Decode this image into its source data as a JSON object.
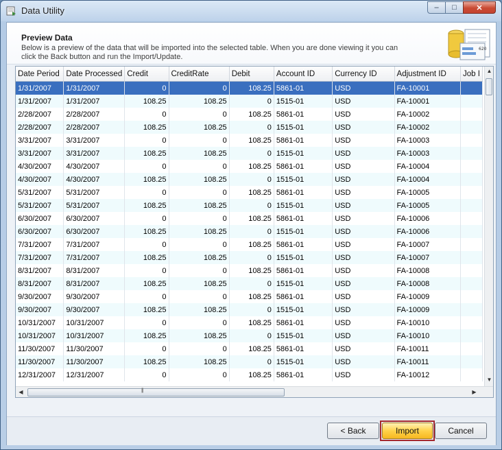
{
  "window": {
    "title": "Data Utility",
    "minimize": "‒",
    "maximize": "□",
    "close": "✕"
  },
  "header": {
    "title": "Preview Data",
    "description": "Below is a preview of the data that will be imported into the selected table.  When you are done viewing it you can click the Back button and run the Import/Update.",
    "icon_badge": "620"
  },
  "grid": {
    "columns": [
      "Date Period",
      "Date Processed",
      "Credit",
      "CreditRate",
      "Debit",
      "Account ID",
      "Currency ID",
      "Adjustment ID",
      "Job I"
    ],
    "rows": [
      [
        "1/31/2007",
        "1/31/2007",
        "0",
        "0",
        "108.25",
        "5861-01",
        "USD",
        "FA-10001",
        ""
      ],
      [
        "1/31/2007",
        "1/31/2007",
        "108.25",
        "108.25",
        "0",
        "1515-01",
        "USD",
        "FA-10001",
        ""
      ],
      [
        "2/28/2007",
        "2/28/2007",
        "0",
        "0",
        "108.25",
        "5861-01",
        "USD",
        "FA-10002",
        ""
      ],
      [
        "2/28/2007",
        "2/28/2007",
        "108.25",
        "108.25",
        "0",
        "1515-01",
        "USD",
        "FA-10002",
        ""
      ],
      [
        "3/31/2007",
        "3/31/2007",
        "0",
        "0",
        "108.25",
        "5861-01",
        "USD",
        "FA-10003",
        ""
      ],
      [
        "3/31/2007",
        "3/31/2007",
        "108.25",
        "108.25",
        "0",
        "1515-01",
        "USD",
        "FA-10003",
        ""
      ],
      [
        "4/30/2007",
        "4/30/2007",
        "0",
        "0",
        "108.25",
        "5861-01",
        "USD",
        "FA-10004",
        ""
      ],
      [
        "4/30/2007",
        "4/30/2007",
        "108.25",
        "108.25",
        "0",
        "1515-01",
        "USD",
        "FA-10004",
        ""
      ],
      [
        "5/31/2007",
        "5/31/2007",
        "0",
        "0",
        "108.25",
        "5861-01",
        "USD",
        "FA-10005",
        ""
      ],
      [
        "5/31/2007",
        "5/31/2007",
        "108.25",
        "108.25",
        "0",
        "1515-01",
        "USD",
        "FA-10005",
        ""
      ],
      [
        "6/30/2007",
        "6/30/2007",
        "0",
        "0",
        "108.25",
        "5861-01",
        "USD",
        "FA-10006",
        ""
      ],
      [
        "6/30/2007",
        "6/30/2007",
        "108.25",
        "108.25",
        "0",
        "1515-01",
        "USD",
        "FA-10006",
        ""
      ],
      [
        "7/31/2007",
        "7/31/2007",
        "0",
        "0",
        "108.25",
        "5861-01",
        "USD",
        "FA-10007",
        ""
      ],
      [
        "7/31/2007",
        "7/31/2007",
        "108.25",
        "108.25",
        "0",
        "1515-01",
        "USD",
        "FA-10007",
        ""
      ],
      [
        "8/31/2007",
        "8/31/2007",
        "0",
        "0",
        "108.25",
        "5861-01",
        "USD",
        "FA-10008",
        ""
      ],
      [
        "8/31/2007",
        "8/31/2007",
        "108.25",
        "108.25",
        "0",
        "1515-01",
        "USD",
        "FA-10008",
        ""
      ],
      [
        "9/30/2007",
        "9/30/2007",
        "0",
        "0",
        "108.25",
        "5861-01",
        "USD",
        "FA-10009",
        ""
      ],
      [
        "9/30/2007",
        "9/30/2007",
        "108.25",
        "108.25",
        "0",
        "1515-01",
        "USD",
        "FA-10009",
        ""
      ],
      [
        "10/31/2007",
        "10/31/2007",
        "0",
        "0",
        "108.25",
        "5861-01",
        "USD",
        "FA-10010",
        ""
      ],
      [
        "10/31/2007",
        "10/31/2007",
        "108.25",
        "108.25",
        "0",
        "1515-01",
        "USD",
        "FA-10010",
        ""
      ],
      [
        "11/30/2007",
        "11/30/2007",
        "0",
        "0",
        "108.25",
        "5861-01",
        "USD",
        "FA-10011",
        ""
      ],
      [
        "11/30/2007",
        "11/30/2007",
        "108.25",
        "108.25",
        "0",
        "1515-01",
        "USD",
        "FA-10011",
        ""
      ],
      [
        "12/31/2007",
        "12/31/2007",
        "0",
        "0",
        "108.25",
        "5861-01",
        "USD",
        "FA-10012",
        ""
      ]
    ],
    "numeric_columns": [
      2,
      3,
      4
    ],
    "selected_row": 0,
    "colors": {
      "selected": "#3a6fbf",
      "alternate": "#effbfd"
    }
  },
  "buttons": {
    "back": "< Back",
    "import": "Import",
    "cancel": "Cancel"
  }
}
